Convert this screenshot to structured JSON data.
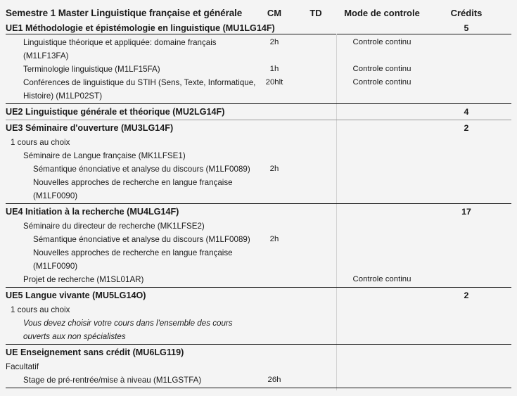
{
  "header": {
    "title": "Semestre 1 Master Linguistique française et générale",
    "columns": {
      "cm": "CM",
      "td": "TD",
      "mode": "Mode de controle",
      "credits": "Crédits"
    }
  },
  "rows": [
    {
      "type": "section",
      "indent": 0,
      "label": "UE1 Méthodologie et épistémologie en linguistique (MU1LG14F)",
      "cm": "",
      "td": "",
      "mode": "",
      "credits": "5"
    },
    {
      "type": "course",
      "indent": 2,
      "label": "Linguistique théorique et appliquée: domaine français",
      "cm": "2h",
      "td": "",
      "mode": "Controle continu",
      "credits": ""
    },
    {
      "type": "course",
      "indent": 2,
      "label": "(M1LF13FA)",
      "cm": "",
      "td": "",
      "mode": "",
      "credits": ""
    },
    {
      "type": "course",
      "indent": 2,
      "label": "Terminologie linguistique (M1LF15FA)",
      "cm": "1h",
      "td": "",
      "mode": "Controle continu",
      "credits": ""
    },
    {
      "type": "course",
      "indent": 2,
      "label": "Conférences de linguistique du STIH (Sens, Texte, Informatique,",
      "cm": "20hlt",
      "td": "",
      "mode": "Controle continu",
      "credits": ""
    },
    {
      "type": "course",
      "indent": 2,
      "label": "Histoire) (M1LP02ST)",
      "cm": "",
      "td": "",
      "mode": "",
      "credits": ""
    },
    {
      "type": "section",
      "indent": 0,
      "label": "UE2 Linguistique générale et théorique (MU2LG14F)",
      "cm": "",
      "td": "",
      "mode": "",
      "credits": "4"
    },
    {
      "type": "section",
      "indent": 0,
      "label": "UE3 Séminaire d'ouverture (MU3LG14F)",
      "cm": "",
      "td": "",
      "mode": "",
      "credits": "2"
    },
    {
      "type": "course",
      "indent": 1,
      "label": "1  cours au choix",
      "cm": "",
      "td": "",
      "mode": "",
      "credits": ""
    },
    {
      "type": "course",
      "indent": 2,
      "label": "Séminaire de Langue française (MK1LFSE1)",
      "cm": "",
      "td": "",
      "mode": "",
      "credits": ""
    },
    {
      "type": "course",
      "indent": 3,
      "label": "Sémantique énonciative et analyse du discours (M1LF0089)",
      "cm": "2h",
      "td": "",
      "mode": "",
      "credits": ""
    },
    {
      "type": "course",
      "indent": 3,
      "label": "Nouvelles approches de recherche en langue française",
      "cm": "",
      "td": "",
      "mode": "",
      "credits": ""
    },
    {
      "type": "course",
      "indent": 3,
      "label": "(M1LF0090)",
      "cm": "",
      "td": "",
      "mode": "",
      "credits": ""
    },
    {
      "type": "section",
      "indent": 0,
      "label": "UE4 Initiation à la recherche (MU4LG14F)",
      "cm": "",
      "td": "",
      "mode": "",
      "credits": "17"
    },
    {
      "type": "course",
      "indent": 2,
      "label": "Séminaire du directeur de recherche (MK1LFSE2)",
      "cm": "",
      "td": "",
      "mode": "",
      "credits": ""
    },
    {
      "type": "course",
      "indent": 3,
      "label": "Sémantique énonciative et analyse du discours (M1LF0089)",
      "cm": "2h",
      "td": "",
      "mode": "",
      "credits": ""
    },
    {
      "type": "course",
      "indent": 3,
      "label": "Nouvelles approches de recherche en langue française",
      "cm": "",
      "td": "",
      "mode": "",
      "credits": ""
    },
    {
      "type": "course",
      "indent": 3,
      "label": "(M1LF0090)",
      "cm": "",
      "td": "",
      "mode": "",
      "credits": ""
    },
    {
      "type": "course",
      "indent": 2,
      "label": "Projet de recherche (M1SL01AR)",
      "cm": "",
      "td": "",
      "mode": "Controle continu",
      "credits": ""
    },
    {
      "type": "section",
      "indent": 0,
      "label": "UE5 Langue vivante (MU5LG14O)",
      "cm": "",
      "td": "",
      "mode": "",
      "credits": "2"
    },
    {
      "type": "course",
      "indent": 1,
      "label": "1  cours au choix",
      "cm": "",
      "td": "",
      "mode": "",
      "credits": ""
    },
    {
      "type": "course",
      "indent": 2,
      "label": "Vous devez choisir votre cours dans l'ensemble des cours",
      "cm": "",
      "td": "",
      "mode": "",
      "credits": "",
      "italic": true
    },
    {
      "type": "course",
      "indent": 2,
      "label": "ouverts aux non spécialistes",
      "cm": "",
      "td": "",
      "mode": "",
      "credits": "",
      "italic": true
    },
    {
      "type": "section",
      "indent": 0,
      "label": "UE Enseignement sans crédit (MU6LG119)",
      "cm": "",
      "td": "",
      "mode": "",
      "credits": ""
    },
    {
      "type": "course",
      "indent": 0,
      "label": "Facultatif",
      "cm": "",
      "td": "",
      "mode": "",
      "credits": ""
    },
    {
      "type": "course",
      "indent": 2,
      "label": "Stage de pré-rentrée/mise à niveau (M1LGSTFA)",
      "cm": "26h",
      "td": "",
      "mode": "",
      "credits": ""
    }
  ],
  "separators": [
    {
      "after_row": 5,
      "weight": "dark"
    },
    {
      "after_row": 6,
      "weight": "light"
    },
    {
      "after_row": 12,
      "weight": "dark"
    },
    {
      "after_row": 18,
      "weight": "dark"
    },
    {
      "after_row": 22,
      "weight": "dark"
    },
    {
      "after_row": 25,
      "weight": "dark"
    }
  ]
}
